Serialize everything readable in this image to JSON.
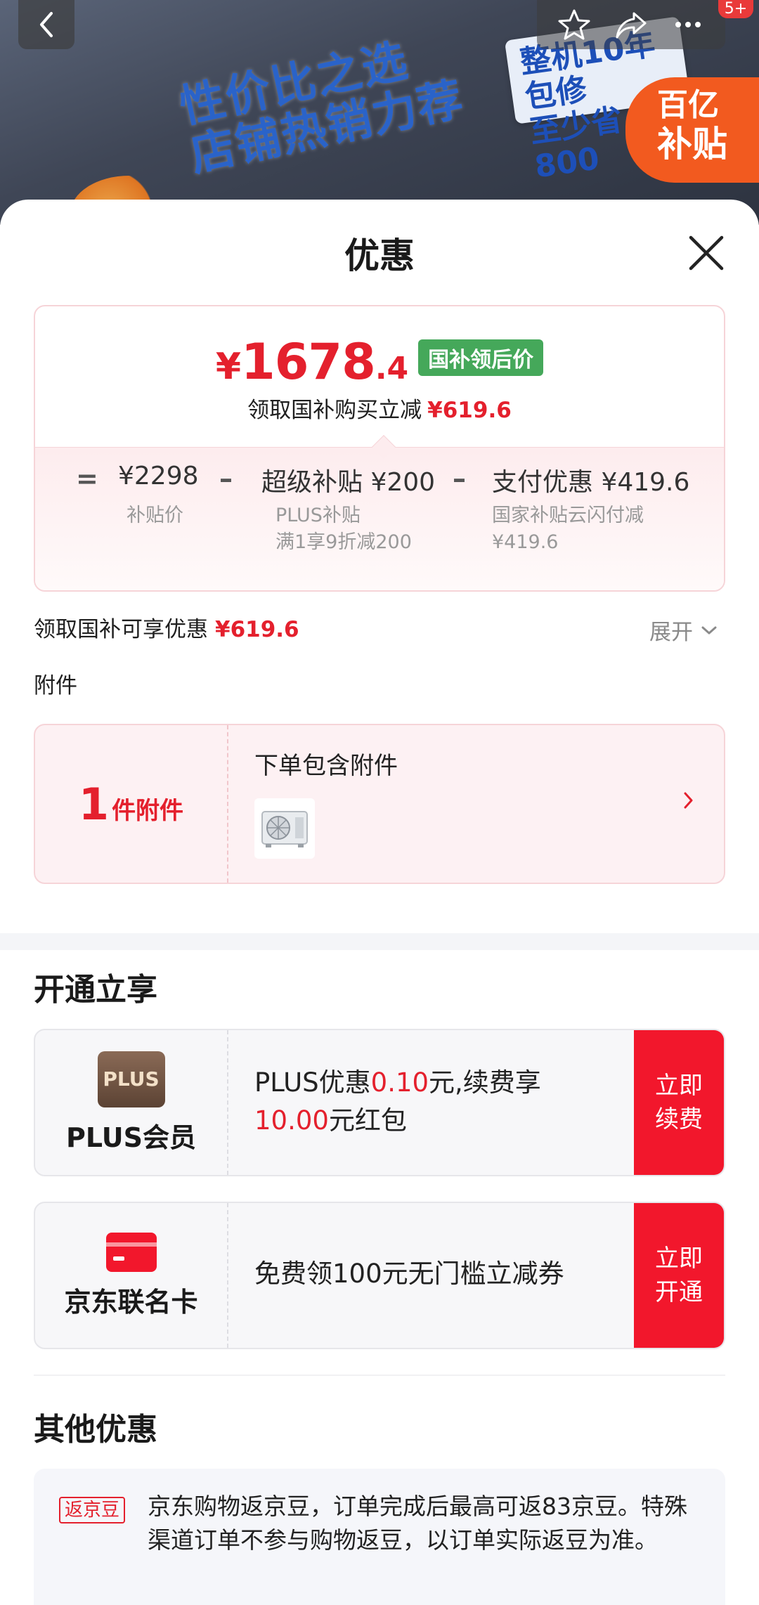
{
  "banner": {
    "slogan_line1": "性价比之选",
    "slogan_line2": "店铺热销力荐",
    "promo_line1": "整机10年包修",
    "promo_line2": "至少省800",
    "subsidy_line1": "百亿",
    "subsidy_line2": "补贴",
    "message_count": "5+"
  },
  "sheet": {
    "title": "优惠"
  },
  "price_card": {
    "currency": "¥",
    "price_int": "1678",
    "price_dec": ".4",
    "price_tag": "国补领后价",
    "subtitle": "领取国补购买立减",
    "subtitle_amount": "¥619.6",
    "eq": "=",
    "base_price": "¥2298",
    "base_label": "补贴价",
    "minus1": "–",
    "super_label": "超级补贴 ¥200",
    "super_detail1": "PLUS补贴",
    "super_detail2": "满1享9折减200",
    "minus2": "–",
    "pay_label": "支付优惠 ¥419.6",
    "pay_detail1": "国家补贴云闪付减",
    "pay_detail2": "¥419.6"
  },
  "enjoy": {
    "label": "领取国补可享优惠",
    "amount": "¥619.6",
    "expand": "展开"
  },
  "attachments": {
    "title": "附件",
    "count": "1",
    "unit": "件附件",
    "desc": "下单包含附件"
  },
  "open_section": {
    "title": "开通立享",
    "plus": {
      "logo": "PLUS",
      "name": "PLUS会员",
      "desc_a": "PLUS优惠",
      "desc_b": "0.10",
      "desc_c": "元,续费享",
      "desc_d": "10.00",
      "desc_e": "元红包",
      "btn_line1": "立即",
      "btn_line2": "续费"
    },
    "jdcard": {
      "name": "京东联名卡",
      "desc": "免费领100元无门槛立减券",
      "btn_line1": "立即",
      "btn_line2": "开通"
    }
  },
  "other_section": {
    "title": "其他优惠",
    "rebate_tag": "返京豆",
    "rebate_text": "京东购物返京豆，订单完成后最高可返83京豆。特殊渠道订单不参与购物返豆，以订单实际返豆为准。"
  },
  "colors": {
    "accent_red": "#e4202d",
    "button_red": "#f2172c",
    "tag_green": "#45a85a"
  }
}
